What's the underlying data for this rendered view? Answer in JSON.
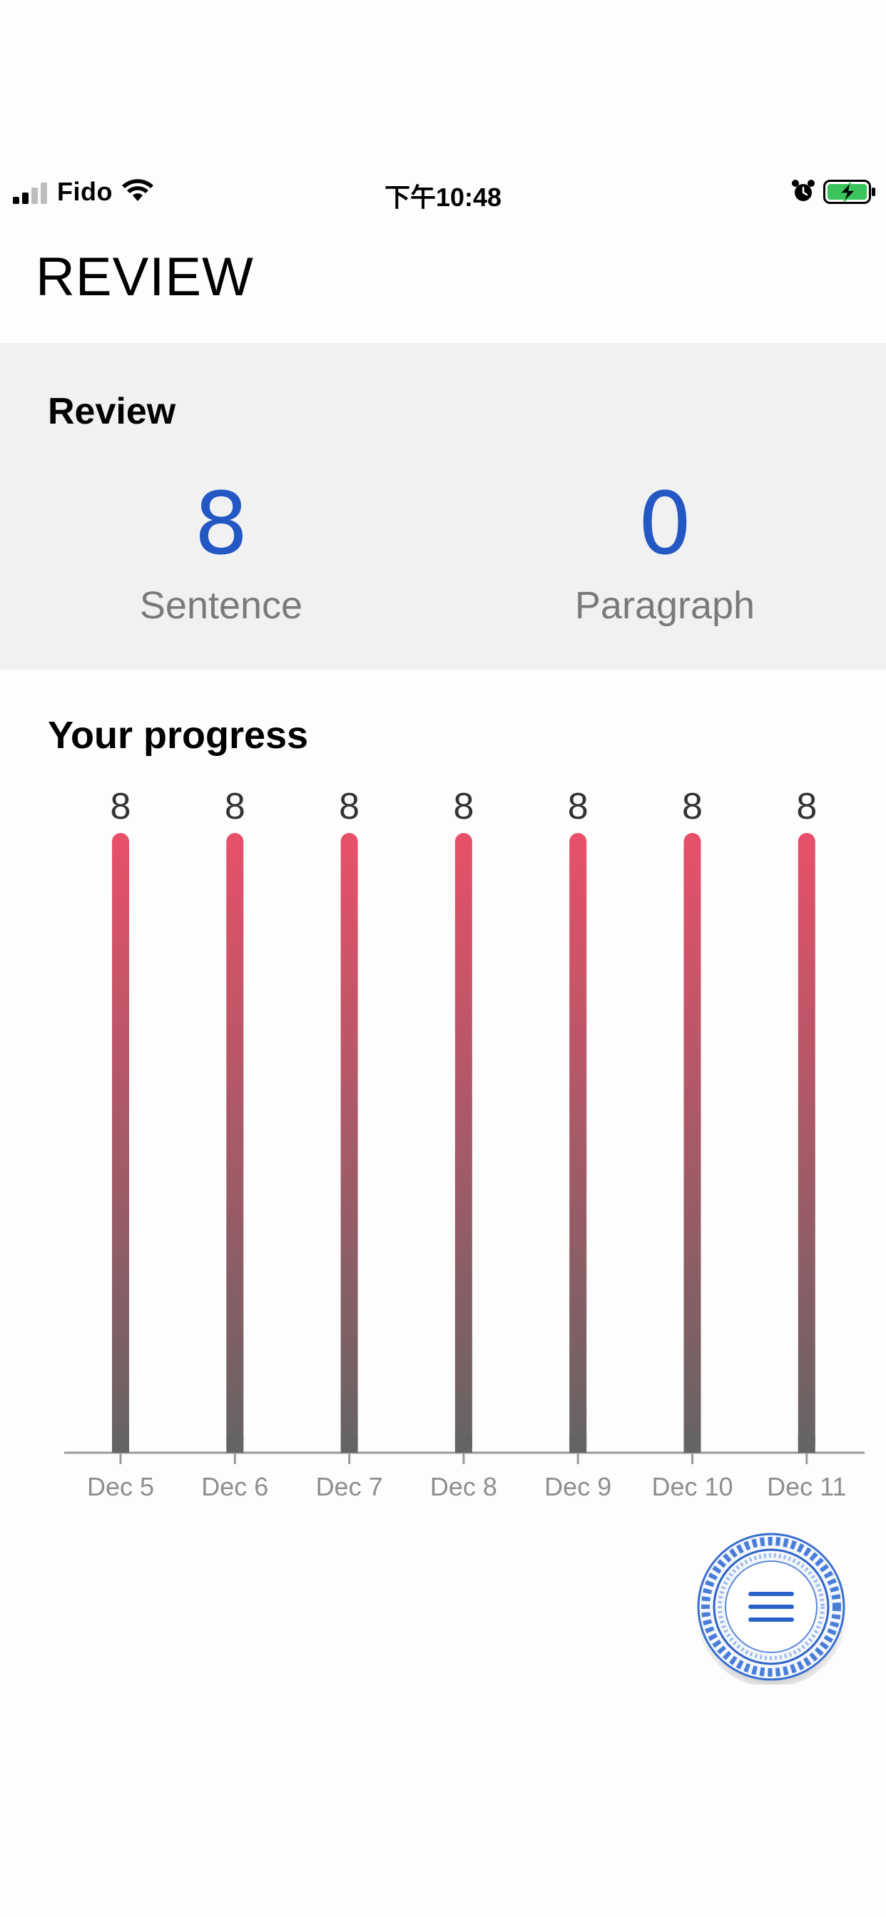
{
  "status_bar": {
    "carrier": "Fido",
    "time": "下午10:48",
    "icons": [
      "signal-icon",
      "wifi-icon",
      "alarm-icon",
      "battery-charging-icon"
    ]
  },
  "page": {
    "title": "REVIEW"
  },
  "review": {
    "heading": "Review",
    "stats": [
      {
        "value": "8",
        "label": "Sentence"
      },
      {
        "value": "0",
        "label": "Paragraph"
      }
    ]
  },
  "progress": {
    "heading": "Your progress"
  },
  "chart_data": {
    "type": "bar",
    "categories": [
      "Dec 5",
      "Dec 6",
      "Dec 7",
      "Dec 8",
      "Dec 9",
      "Dec 10",
      "Dec 11"
    ],
    "values": [
      8,
      8,
      8,
      8,
      8,
      8,
      8
    ],
    "title": "Your progress",
    "xlabel": "",
    "ylabel": "",
    "ylim": [
      0,
      8
    ],
    "grid": false,
    "bar_gradient": [
      "#e8506a",
      "#646464"
    ],
    "axis_color": "#9a9a9a"
  },
  "fab": {
    "icon": "menu-icon",
    "accent": "#2a62c9"
  },
  "colors": {
    "accent": "#2257c4",
    "panel_bg": "#f1f1f1"
  }
}
